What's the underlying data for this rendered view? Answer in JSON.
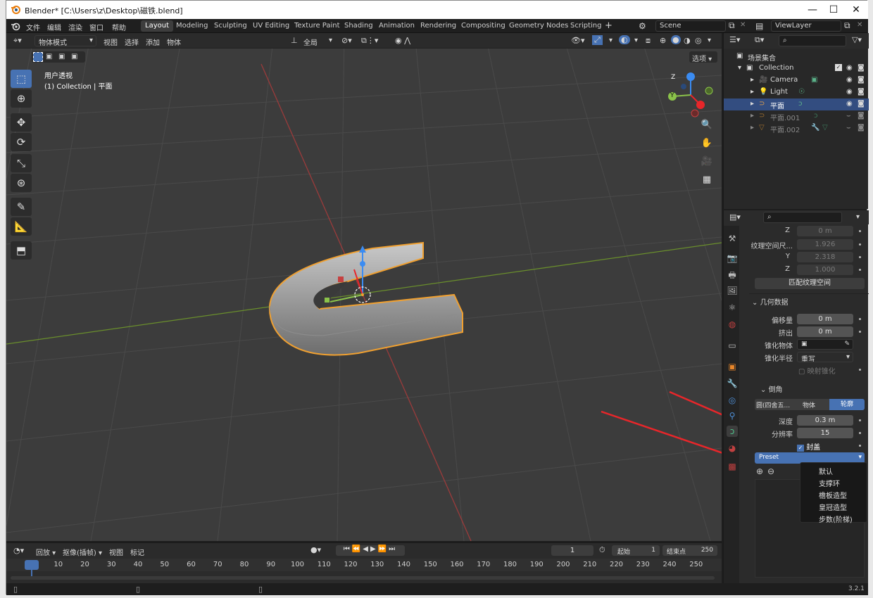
{
  "window": {
    "title": "Blender* [C:\\Users\\z\\Desktop\\磁铁.blend]",
    "minimize": "—",
    "maximize": "☐",
    "close": "✕"
  },
  "menu": [
    "文件",
    "编辑",
    "渲染",
    "窗口",
    "帮助"
  ],
  "workspaces": [
    "Layout",
    "Modeling",
    "Sculpting",
    "UV Editing",
    "Texture Paint",
    "Shading",
    "Animation",
    "Rendering",
    "Compositing",
    "Geometry Nodes",
    "Scripting"
  ],
  "workspace_add": "+",
  "scene": "Scene",
  "view_layer": "ViewLayer",
  "viewport": {
    "mode": "物体模式",
    "menus": [
      "视图",
      "选择",
      "添加",
      "物体"
    ],
    "transform": "全局",
    "options": "选项",
    "overlay_title": "用户透视",
    "overlay_sub": "(1) Collection | 平面",
    "gizmo": {
      "z": "Z",
      "y": "Y"
    }
  },
  "outliner": {
    "root": "场景集合",
    "collection": "Collection",
    "items": [
      {
        "name": "Camera"
      },
      {
        "name": "Light"
      },
      {
        "name": "平面"
      },
      {
        "name": "平面.001"
      },
      {
        "name": "平面.002"
      }
    ]
  },
  "properties": {
    "z_label": "Z",
    "z_value": "0 m",
    "texspace_label": "纹理空间尺...",
    "tex_x": "1.926",
    "tex_y_label": "Y",
    "tex_y": "2.318",
    "tex_z_label": "Z",
    "tex_z": "1.000",
    "match_btn": "匹配纹理空间",
    "geometry_header": "几何数据",
    "offset_label": "偏移量",
    "offset": "0 m",
    "extrude_label": "挤出",
    "extrude": "0 m",
    "taper_label": "锥化物体",
    "taper_radius_label": "锥化半径",
    "taper_radius": "重写",
    "map_taper": "映射锥化",
    "bevel_header": "倒角",
    "bevel_tabs": [
      "圆(四舍五...",
      "物体",
      "轮廓"
    ],
    "depth_label": "深度",
    "depth": "0.3 m",
    "resolution_label": "分辨率",
    "resolution": "15",
    "fill_caps": "封盖",
    "preset": "Preset",
    "dropdown": [
      "默认",
      "支撑环",
      "檐板造型",
      "皇冠造型",
      "步数(阶梯)"
    ]
  },
  "timeline": {
    "menus": [
      "回放",
      "抠像(插帧)",
      "视图",
      "标记"
    ],
    "current_frame": "1",
    "start_label": "起始",
    "start": "1",
    "end_label": "结束点",
    "end": "250",
    "ticks": [
      "1",
      "10",
      "20",
      "30",
      "40",
      "50",
      "60",
      "70",
      "80",
      "90",
      "100",
      "110",
      "120",
      "130",
      "140",
      "150",
      "160",
      "170",
      "180",
      "190",
      "200",
      "210",
      "220",
      "230",
      "240",
      "250"
    ]
  },
  "status": {
    "version": "3.2.1"
  },
  "colors": {
    "accent": "#4772b3",
    "selection": "#334d80",
    "orange_outline": "#f0a030",
    "red_arrow": "#e8262a"
  }
}
